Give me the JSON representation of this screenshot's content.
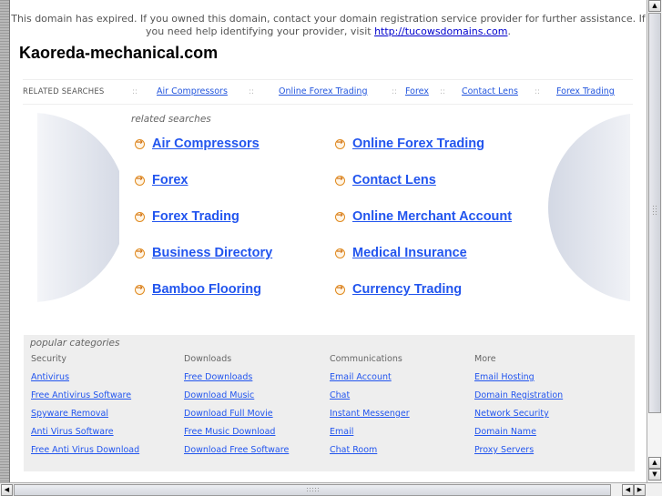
{
  "notice": {
    "text": "This domain has expired. If you owned this domain, contact your domain registration service provider for further assistance. If you need help identifying your provider, visit ",
    "link": "http://tucowsdomains.com",
    "suffix": "."
  },
  "site_title": "Kaoreda-mechanical.com",
  "related_bar": {
    "label": "RELATED SEARCHES",
    "separator": "::",
    "links": [
      "Air Compressors",
      "Online Forex Trading",
      "Forex",
      "Contact Lens",
      "Forex Trading"
    ]
  },
  "related_searches": {
    "label": "related searches",
    "icon": "orange-arrow-circle-icon",
    "left": [
      "Air Compressors",
      "Forex",
      "Forex Trading",
      "Business Directory",
      "Bamboo Flooring"
    ],
    "right": [
      "Online Forex Trading",
      "Contact Lens",
      "Online Merchant Account",
      "Medical Insurance",
      "Currency Trading"
    ]
  },
  "popular_categories": {
    "title": "popular categories",
    "columns": [
      {
        "heading": "Security",
        "links": [
          "Antivirus",
          "Free Antivirus Software",
          "Spyware Removal",
          "Anti Virus Software",
          "Free Anti Virus Download"
        ]
      },
      {
        "heading": "Downloads",
        "links": [
          "Free Downloads",
          "Download Music",
          "Download Full Movie",
          "Free Music Download",
          "Download Free Software"
        ]
      },
      {
        "heading": "Communications",
        "links": [
          "Email Account",
          "Chat",
          "Instant Messenger",
          "Email",
          "Chat Room"
        ]
      },
      {
        "heading": "More",
        "links": [
          "Email Hosting",
          "Domain Registration",
          "Network Security",
          "Domain Name",
          "Proxy Servers"
        ]
      }
    ]
  },
  "scrollbars": {
    "up": "▲",
    "down": "▼",
    "left": "◀",
    "right": "▶"
  },
  "colors": {
    "link": "#2255ee",
    "accent_arrow": "#e08a1e",
    "panel_bg": "#eeeeee"
  }
}
